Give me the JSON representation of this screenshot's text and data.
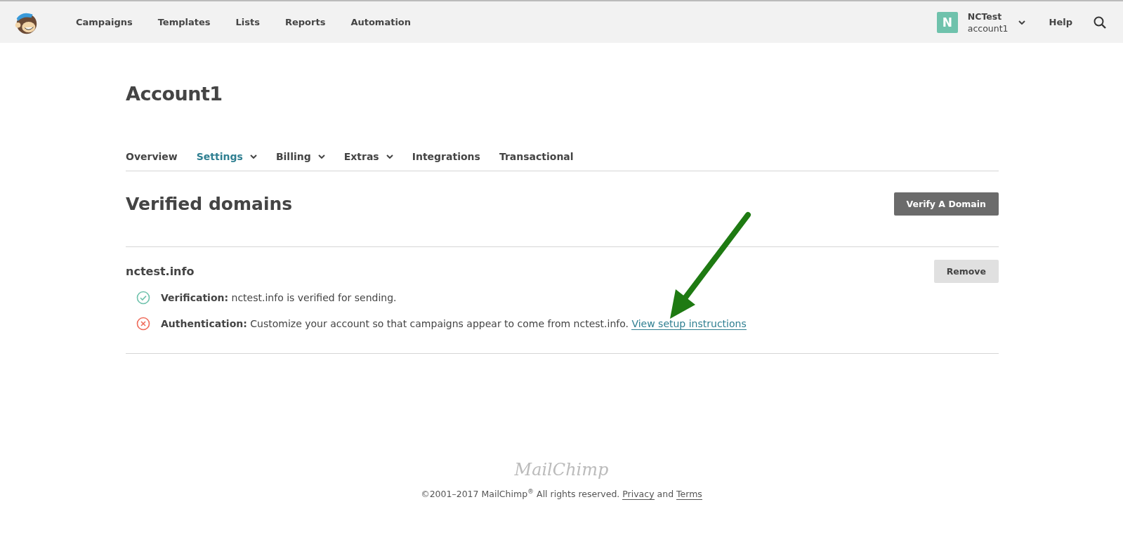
{
  "header": {
    "nav": [
      {
        "label": "Campaigns"
      },
      {
        "label": "Templates"
      },
      {
        "label": "Lists"
      },
      {
        "label": "Reports"
      },
      {
        "label": "Automation"
      }
    ],
    "account": {
      "initial": "N",
      "name": "NCTest",
      "sub": "account1"
    },
    "help": "Help"
  },
  "page_title": "Account1",
  "tabs": [
    {
      "label": "Overview",
      "selected": false,
      "dropdown": false
    },
    {
      "label": "Settings",
      "selected": true,
      "dropdown": true
    },
    {
      "label": "Billing",
      "selected": false,
      "dropdown": true
    },
    {
      "label": "Extras",
      "selected": false,
      "dropdown": true
    },
    {
      "label": "Integrations",
      "selected": false,
      "dropdown": false
    },
    {
      "label": "Transactional",
      "selected": false,
      "dropdown": false
    }
  ],
  "section": {
    "title": "Verified domains",
    "button": "Verify A Domain"
  },
  "domains": [
    {
      "name": "nctest.info",
      "button": "Remove",
      "statuses": [
        {
          "kind": "ok",
          "label": "Verification:",
          "text": "nctest.info is verified for sending."
        },
        {
          "kind": "error",
          "label": "Authentication:",
          "text": "Customize your account so that campaigns appear to come from nctest.info.",
          "link": "View setup instructions"
        }
      ]
    }
  ],
  "footer": {
    "logo": "MailChimp",
    "copyright": "©2001–2017 MailChimp$^{®}$ All rights reserved.",
    "privacy": "Privacy",
    "and": "and",
    "terms": "Terms"
  }
}
